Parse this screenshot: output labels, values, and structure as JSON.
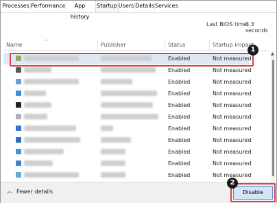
{
  "tabs": [
    "Processes",
    "Performance",
    "App history",
    "Startup",
    "Users",
    "Details",
    "Services"
  ],
  "active_tab": "Startup",
  "bios": {
    "label": "Last BIOS time:",
    "value": "3.3 seconds"
  },
  "columns": {
    "name": "Name",
    "publisher": "Publisher",
    "status": "Status",
    "impact": "Startup impact"
  },
  "rows": [
    {
      "status": "Enabled",
      "impact": "Not measured",
      "icon_color": "#9aa66a"
    },
    {
      "status": "Enabled",
      "impact": "Not measured",
      "icon_color": "#5a5a5a"
    },
    {
      "status": "Enabled",
      "impact": "Not measured",
      "icon_color": "#6aa0d8"
    },
    {
      "status": "Enabled",
      "impact": "Not measured",
      "icon_color": "#3a8fd8"
    },
    {
      "status": "Enabled",
      "impact": "Not measured",
      "icon_color": "#222222"
    },
    {
      "status": "Enabled",
      "impact": "Not measured",
      "icon_color": "#aab2bb"
    },
    {
      "status": "Enabled",
      "impact": "Not measured",
      "icon_color": "#3a74c8"
    },
    {
      "status": "Enabled",
      "impact": "Not measured",
      "icon_color": "#2d6fc0"
    },
    {
      "status": "Enabled",
      "impact": "Not measured",
      "icon_color": "#4a90d0"
    },
    {
      "status": "Enabled",
      "impact": "Not measured",
      "icon_color": "#3e86c8"
    },
    {
      "status": "Enabled",
      "impact": "Not measured",
      "icon_color": "#6aa8d8"
    }
  ],
  "callouts": [
    "1",
    "2"
  ],
  "footer": {
    "fewer_details": "Fewer details",
    "disable": "Disable"
  },
  "colors": {
    "accent_red": "#e0404a",
    "selected_row": "#dfe9f5",
    "button_blue": "#d4e5f7"
  }
}
